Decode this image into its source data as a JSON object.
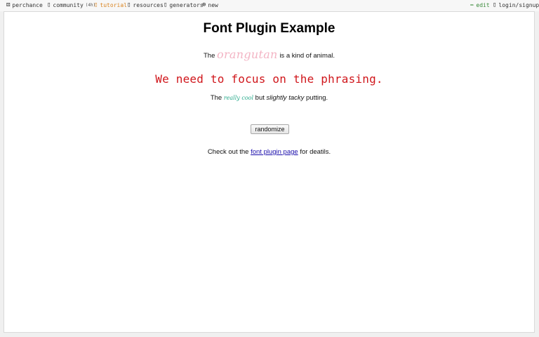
{
  "nav": {
    "home_label": "perchance",
    "community_label": "community",
    "community_badge": "(4h)",
    "tutorial_label": "tutorial",
    "resources_label": "resources",
    "generators_label": "generators",
    "new_label": "new",
    "edit_label": "edit",
    "login_label": "login/signup",
    "colors": {
      "tutorial": "#d9831f",
      "edit": "#3a8a3a"
    },
    "icons": {
      "home": "dice-icon",
      "community": "chat-icon",
      "tutorial": "book-icon",
      "resources": "list-icon",
      "generators": "grid-icon",
      "new": "plus-circle-icon",
      "edit": "pencil-icon",
      "login": "user-icon"
    }
  },
  "page": {
    "title": "Font Plugin Example",
    "line1": {
      "prefix": "The",
      "animal": "orangutan",
      "suffix": "is a kind of animal."
    },
    "line2": "We need to focus on the phrasing.",
    "line3": {
      "prefix": "The",
      "fancy": "really cool",
      "middle": "but",
      "slanted": "slightly tacky",
      "suffix": "putting."
    },
    "button_label": "randomize",
    "footer": {
      "prefix": "Check out the",
      "link": "font plugin page",
      "suffix": "for deatils."
    },
    "colors": {
      "animal": "#f3b4c4",
      "phrasing": "#d0161b",
      "cool": "#26a98a",
      "link": "#1a0dab"
    }
  }
}
